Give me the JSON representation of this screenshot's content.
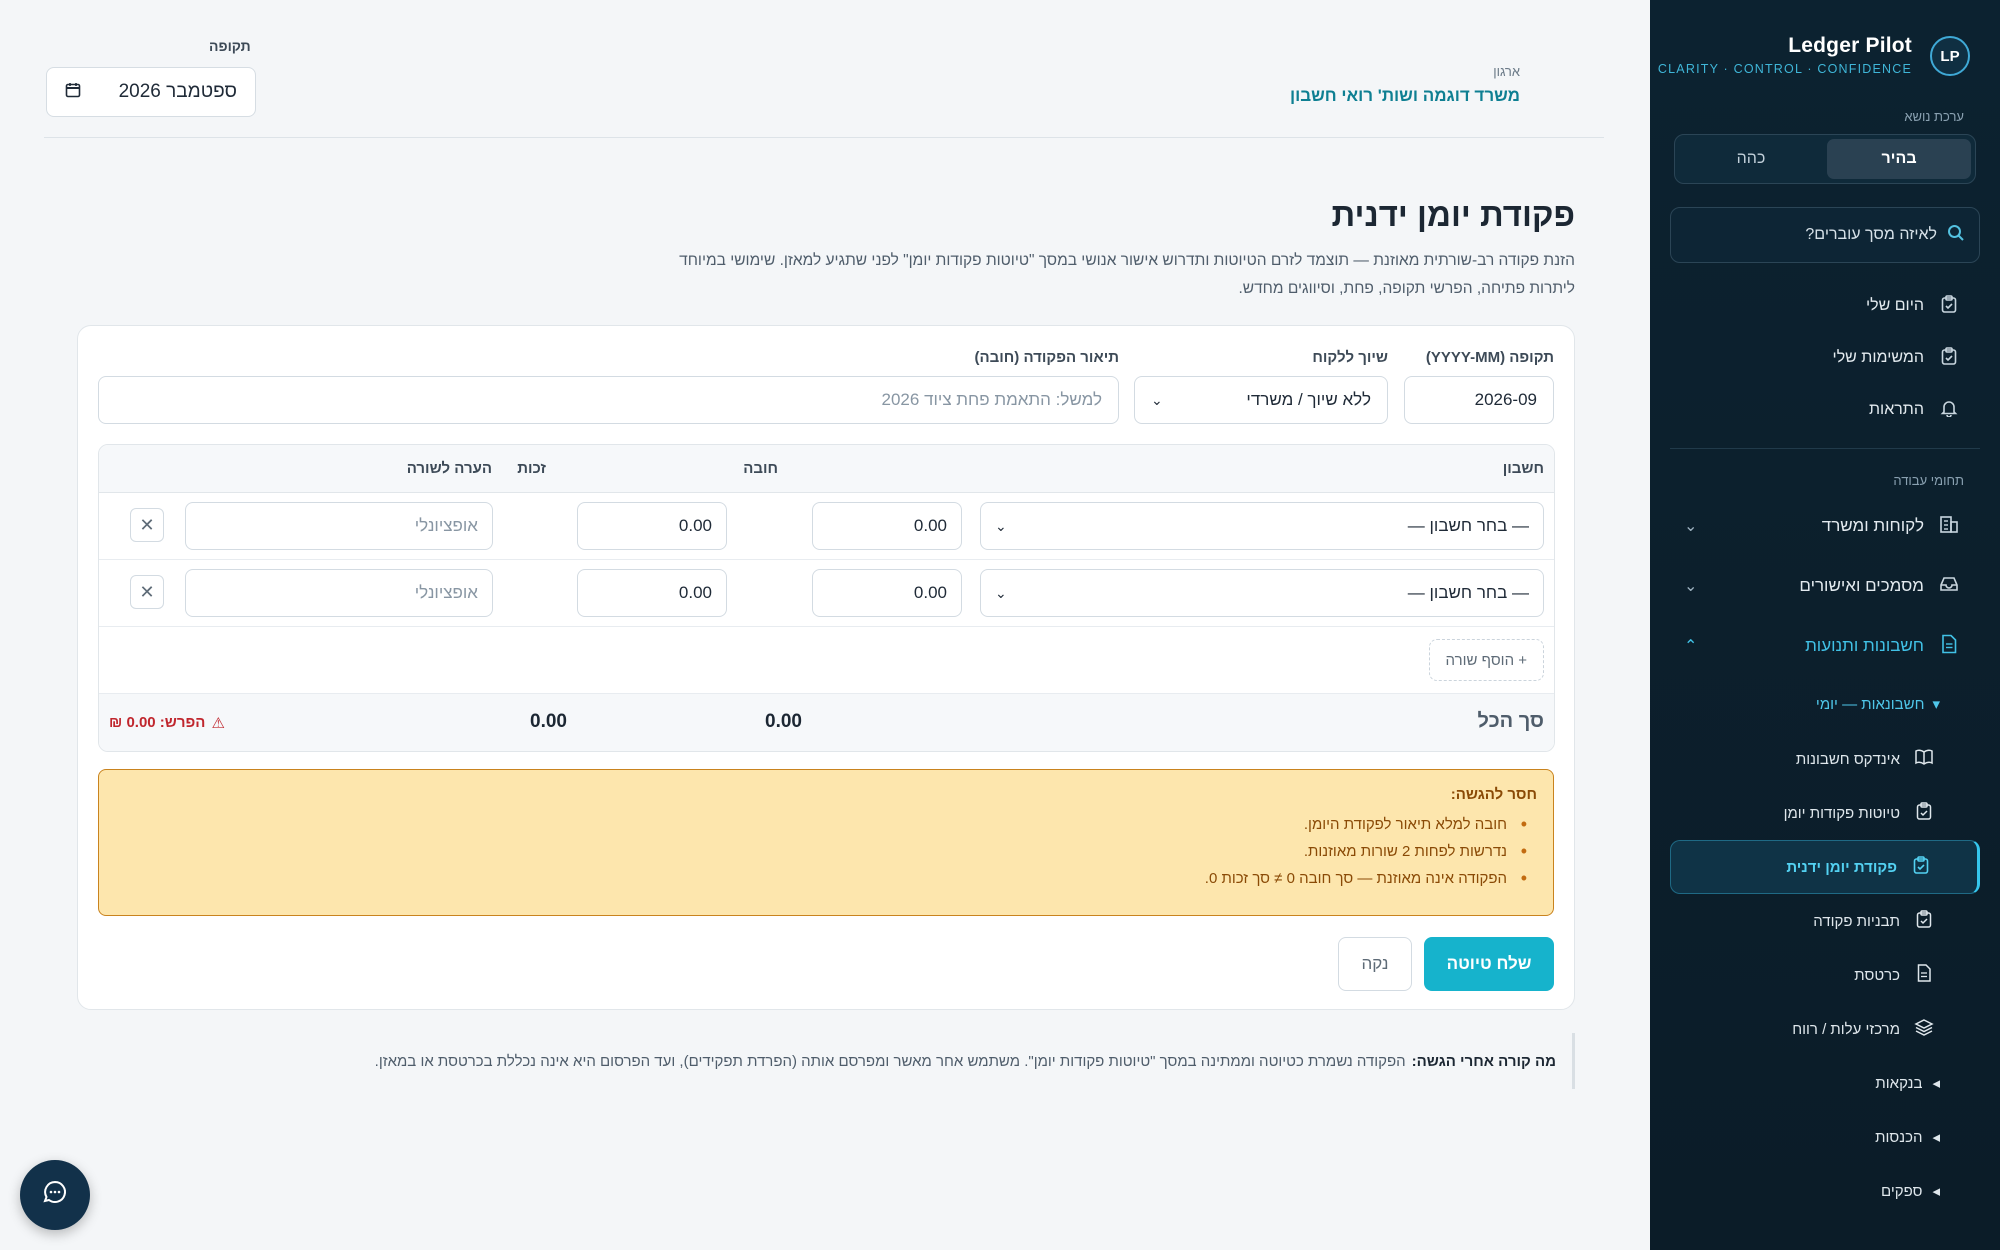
{
  "brand": {
    "logo_text": "LP",
    "name": "Ledger Pilot",
    "tagline": "CLARITY · CONTROL · CONFIDENCE",
    "accent": "#3fb6d8"
  },
  "theme": {
    "label": "ערכת נושא",
    "light": "בהיר",
    "dark": "כהה",
    "selected": "בהיר"
  },
  "search": {
    "placeholder": "לאיזה מסך עוברים?"
  },
  "nav": {
    "top_items": [
      {
        "label": "היום שלי",
        "icon": "clipboard-icon"
      },
      {
        "label": "המשימות שלי",
        "icon": "clipboard-icon"
      },
      {
        "label": "התראות",
        "icon": "bell-icon"
      }
    ],
    "section_label": "תחומי עבודה",
    "groups": [
      {
        "label": "לקוחות ומשרד",
        "icon": "building-icon"
      },
      {
        "label": "מסמכים ואישורים",
        "icon": "inbox-icon"
      },
      {
        "label": "חשבונות ותנועות",
        "icon": "document-icon"
      }
    ],
    "subgroup_title": "חשבונאות — יומי",
    "sub_items": [
      {
        "label": "אינדקס חשבונות",
        "icon": "book-icon"
      },
      {
        "label": "טיוטות פקודות יומן",
        "icon": "clipboard-icon"
      },
      {
        "label": "פקודת יומן ידנית",
        "icon": "clipboard-icon"
      },
      {
        "label": "תבניות פקודה",
        "icon": "clipboard-icon"
      },
      {
        "label": "כרטסת",
        "icon": "document-icon"
      },
      {
        "label": "מרכזי עלות / רווח",
        "icon": "layers-icon"
      }
    ],
    "collapsed": [
      {
        "label": "בנקאות"
      },
      {
        "label": "הכנסות"
      },
      {
        "label": "ספקים"
      }
    ]
  },
  "header": {
    "org_label": "ארגון",
    "org_name": "משרד דוגמה ושות' רואי חשבון",
    "period_label": "תקופה",
    "period_value": "ספטמבר 2026"
  },
  "page": {
    "title": "פקודת יומן ידנית",
    "description": "הזנת פקודה רב-שורתית מאוזנת — תוצמד לזרם הטיוטות ותדרוש אישור אנושי במסך \"טיוטות פקודות יומן\" לפני שתגיע למאזן. שימושי במיוחד ליתרות פתיחה, הפרשי תקופה, פחת, וסיווגים מחדש."
  },
  "form": {
    "period_label": "תקופה (YYYY-MM)",
    "period_value": "2026-09",
    "client_label": "שיוך ללקוח",
    "client_value": "ללא שיוך / משרדי",
    "desc_label": "תיאור הפקודה (חובה)",
    "desc_placeholder": "למשל: התאמת פחת ציוד 2026"
  },
  "grid": {
    "headers": {
      "account": "חשבון",
      "debit": "חובה",
      "credit": "זכות",
      "note": "הערה לשורה"
    },
    "rows": [
      {
        "account": "— בחר חשבון —",
        "debit": "0.00",
        "credit": "0.00",
        "note_placeholder": "אופציונלי"
      },
      {
        "account": "— בחר חשבון —",
        "debit": "0.00",
        "credit": "0.00",
        "note_placeholder": "אופציונלי"
      }
    ],
    "add_row": "+ הוסף שורה",
    "totals": {
      "label": "סך הכל",
      "debit": "0.00",
      "credit": "0.00",
      "difference": "הפרש: 0.00 ₪"
    }
  },
  "alert": {
    "title": "חסר להגשה:",
    "items": [
      "חובה למלא תיאור לפקודת היומן.",
      "נדרשות לפחות 2 שורות מאוזנות.",
      "הפקודה אינה מאוזנת — סך חובה 0 ≠ סך זכות 0."
    ]
  },
  "actions": {
    "submit": "שלח טיוטה",
    "clear": "נקה"
  },
  "footer_note": {
    "title": "מה קורה אחרי הגשה:",
    "text": "הפקודה נשמרת כטיוטה וממתינה במסך \"טיוטות פקודות יומן\". משתמש אחר מאשר ומפרסם אותה (הפרדת תפקידים), ועד הפרסום היא אינה נכללת בכרטסת או במאזן."
  },
  "colors": {
    "primary": "#16b3cc",
    "sidebar_bg": "#0c2230",
    "warning_bg": "#fde6ad",
    "warning_text": "#8a4a06",
    "danger": "#c0262d"
  }
}
